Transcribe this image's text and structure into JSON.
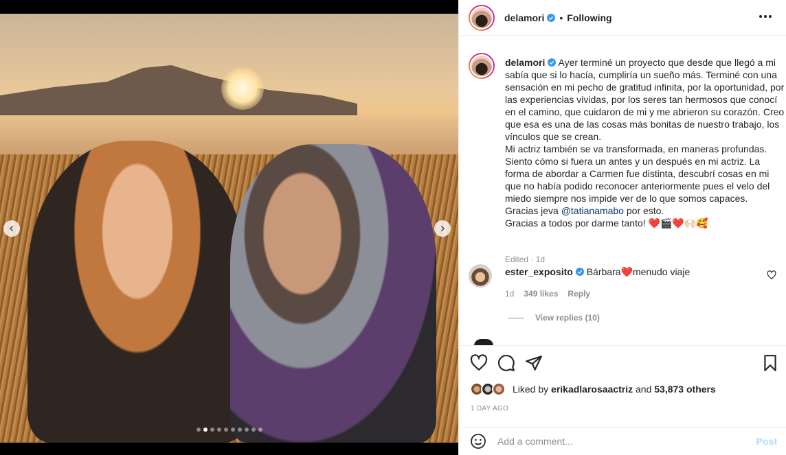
{
  "header": {
    "username": "delamori",
    "separator": "•",
    "follow_status": "Following"
  },
  "caption": {
    "username": "delamori",
    "text": "Ayer terminé un proyecto que desde que llegó a mi sabía que si lo hacía, cumpliría un sueño más. Terminé con una sensación en mi pecho de gratitud infinita, por la oportunidad, por las experiencias vividas, por los seres tan hermosos que conocí en el camino, que cuidaron de mi y me abrieron su corazón. Creo que esa es una de las cosas más bonitas de nuestro trabajo, los vínculos que se crean.\nMi actriz también se va transformada, en maneras profundas. Siento cómo si fuera un antes y un después en mi actriz. La forma de abordar a Carmen fue distinta, descubrí cosas en mi que no había podido reconocer anteriormente pues el velo del miedo siempre nos impide ver de lo que somos capaces.\nGracias jeva ",
    "mention": "@tatianamabo",
    "after_mention": " por esto.\nGracias a todos por darme tanto! ❤️🎬❤️🙌🏻🥰",
    "edited": "Edited · 1d"
  },
  "comment": {
    "username": "ester_exposito",
    "text": "Bárbara❤️menudo viaje",
    "time": "1d",
    "likes": "349 likes",
    "reply": "Reply",
    "view_replies": "View replies (10)"
  },
  "likes": {
    "prefix": "Liked by ",
    "user": "erikadlarosaactriz",
    "middle": " and ",
    "others": "53,873 others"
  },
  "timestamp": "1 DAY AGO",
  "add_comment": {
    "placeholder": "Add a comment...",
    "post_label": "Post"
  },
  "carousel": {
    "total_slides": 10,
    "active_index": 1
  },
  "colors": {
    "verified": "#3897f0",
    "mention": "#00376b",
    "post_disabled": "#b3dbff",
    "heart": "#ed4956"
  }
}
